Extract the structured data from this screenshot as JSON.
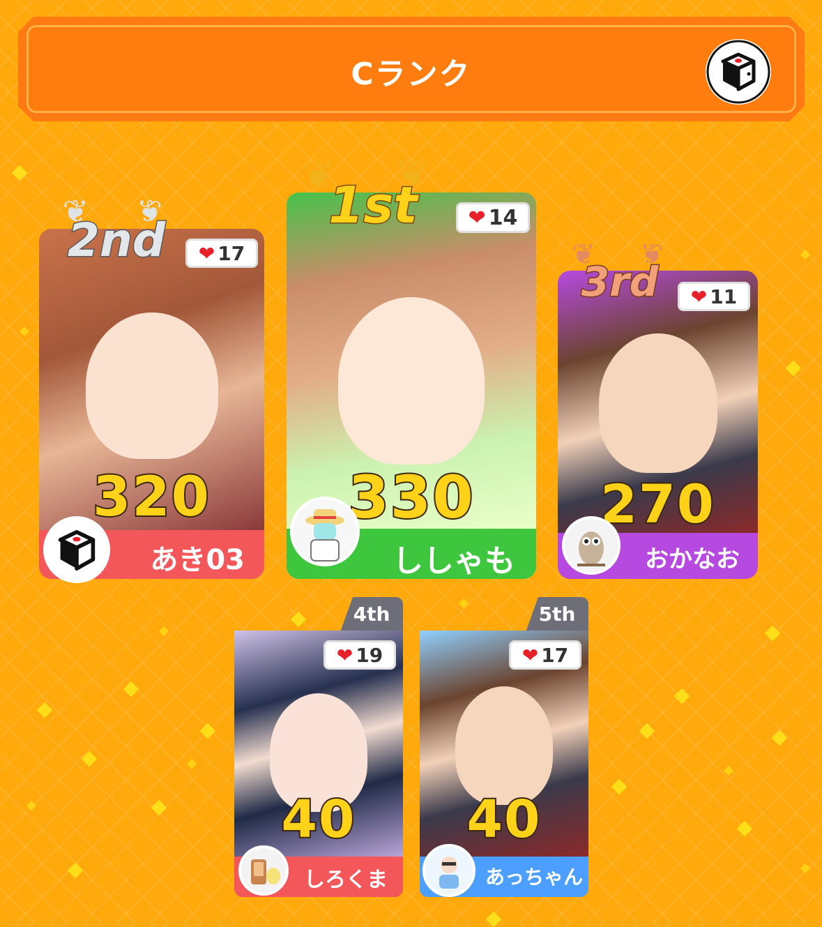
{
  "header": {
    "title": "Cランク",
    "icon": "dice-icon"
  },
  "colors": {
    "background": "#ffa90c",
    "header": "#ff7a12",
    "card_red": "#f4575a",
    "card_green": "#3ec63e",
    "card_purple": "#b64ae0",
    "card_blue": "#4d9fff",
    "score_fill": "#ffd21a"
  },
  "players": [
    {
      "rank": "2nd",
      "likes": "17",
      "score": "320",
      "name": "あき03",
      "color": "#f4575a",
      "avatar": "dice-icon"
    },
    {
      "rank": "1st",
      "likes": "14",
      "score": "330",
      "name": "ししゃも",
      "color": "#3ec63e",
      "avatar": "sketch-avatar"
    },
    {
      "rank": "3rd",
      "likes": "11",
      "score": "270",
      "name": "おかなお",
      "color": "#b64ae0",
      "avatar": "owl-icon"
    },
    {
      "rank": "4th",
      "likes": "19",
      "score": "40",
      "name": "しろくま",
      "color": "#f4575a",
      "avatar": "heater-avatar"
    },
    {
      "rank": "5th",
      "likes": "17",
      "score": "40",
      "name": "あっちゃん",
      "color": "#4d9fff",
      "avatar": "cartoon-avatar"
    }
  ]
}
